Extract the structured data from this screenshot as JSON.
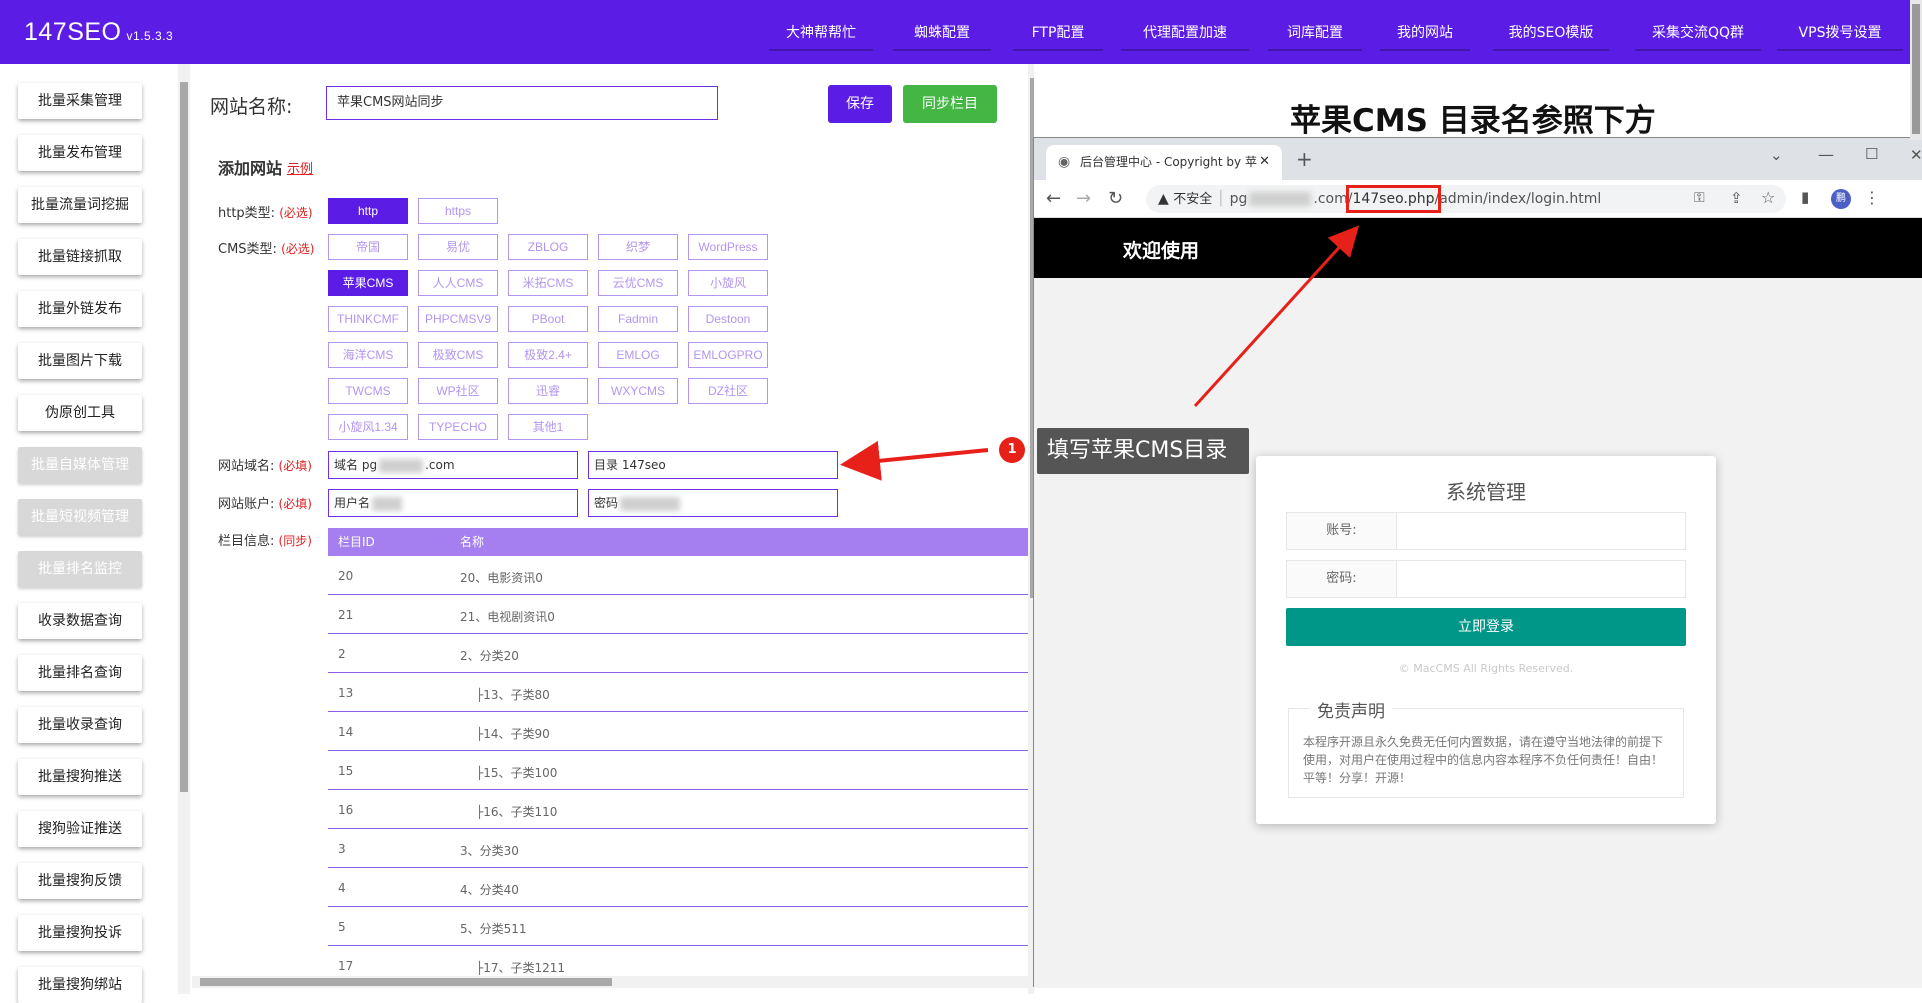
{
  "app": {
    "name": "147SEO",
    "version": "v1.5.3.3"
  },
  "nav": [
    "大神帮帮忙",
    "蜘蛛配置",
    "FTP配置",
    "代理配置加速",
    "词库配置",
    "我的网站",
    "我的SEO模版",
    "采集交流QQ群",
    "VPS拨号设置"
  ],
  "sidebar": [
    "批量采集管理",
    "批量发布管理",
    "批量流量词挖掘",
    "批量链接抓取",
    "批量外链发布",
    "批量图片下载",
    "伪原创工具",
    "批量自媒体管理",
    "批量短视频管理",
    "批量排名监控",
    "收录数据查询",
    "批量排名查询",
    "批量收录查询",
    "批量搜狗推送",
    "搜狗验证推送",
    "批量搜狗反馈",
    "批量搜狗投诉",
    "批量搜狗绑站"
  ],
  "form": {
    "site_name_label": "网站名称:",
    "site_name_value": "苹果CMS网站同步",
    "save": "保存",
    "sync": "同步栏目",
    "add_site": "添加网站",
    "example": "示例",
    "http_label": "http类型:",
    "cms_label": "CMS类型:",
    "domain_label": "网站域名:",
    "account_label": "网站账户:",
    "column_label": "栏目信息:",
    "required": "(必选)",
    "required_fill": "(必填)",
    "sync_hint": "(同步)",
    "http_options": [
      "http",
      "https"
    ],
    "cms_options": [
      "帝国",
      "易优",
      "ZBLOG",
      "织梦",
      "WordPress",
      "苹果CMS",
      "人人CMS",
      "米拓CMS",
      "云优CMS",
      "小旋风",
      "THINKCMF",
      "PHPCMSV9",
      "PBoot",
      "Fadmin",
      "Destoon",
      "海洋CMS",
      "极致CMS",
      "极致2.4+",
      "EMLOG",
      "EMLOGPRO",
      "TWCMS",
      "WP社区",
      "迅睿",
      "WXYCMS",
      "DZ社区",
      "小旋风1.34",
      "TYPECHO",
      "其他1"
    ],
    "selected_http": "http",
    "selected_cms": "苹果CMS",
    "domain_prefix": "域名",
    "domain_start": "pg",
    "domain_end": ".com",
    "dir_prefix": "目录",
    "dir_value": "147seo",
    "user_prefix": "用户名",
    "pass_prefix": "密码"
  },
  "table": {
    "headers": [
      "栏目ID",
      "名称"
    ],
    "rows": [
      {
        "id": "20",
        "name": "20、电影资讯0"
      },
      {
        "id": "21",
        "name": "21、电视剧资讯0"
      },
      {
        "id": "2",
        "name": "2、分类20"
      },
      {
        "id": "13",
        "name": "├13、子类80"
      },
      {
        "id": "14",
        "name": "├14、子类90"
      },
      {
        "id": "15",
        "name": "├15、子类100"
      },
      {
        "id": "16",
        "name": "├16、子类110"
      },
      {
        "id": "3",
        "name": "3、分类30"
      },
      {
        "id": "4",
        "name": "4、分类40"
      },
      {
        "id": "5",
        "name": "5、分类511"
      },
      {
        "id": "17",
        "name": "├17、子类1211"
      }
    ]
  },
  "overlay": {
    "title": "苹果CMS 目录名参照下方",
    "callout_number": "1",
    "callout_text": "填写苹果CMS目录"
  },
  "browser": {
    "tab_title": "后台管理中心 - Copyright by 苹",
    "insecure": "不安全",
    "url_start": "pg",
    "url_mid": ".com/",
    "url_highlight": "147seo.php",
    "url_end": "/admin/index/login.html",
    "welcome": "欢迎使用",
    "login_title": "系统管理",
    "account_label": "账号:",
    "password_label": "密码:",
    "login_button": "立即登录",
    "copyright": "© MacCMS All Rights Reserved.",
    "disclaimer_title": "免责声明",
    "disclaimer_text": "本程序开源且永久免费无任何内置数据，请在遵守当地法律的前提下使用，对用户在使用过程中的信息内容本程序不负任何责任！自由！平等！分享！开源！",
    "avatar_letter": "鹏"
  },
  "colors": {
    "brand": "#5b1de6",
    "accent_green": "#43b644",
    "login_green": "#009688",
    "highlight_red": "#e8201a"
  }
}
